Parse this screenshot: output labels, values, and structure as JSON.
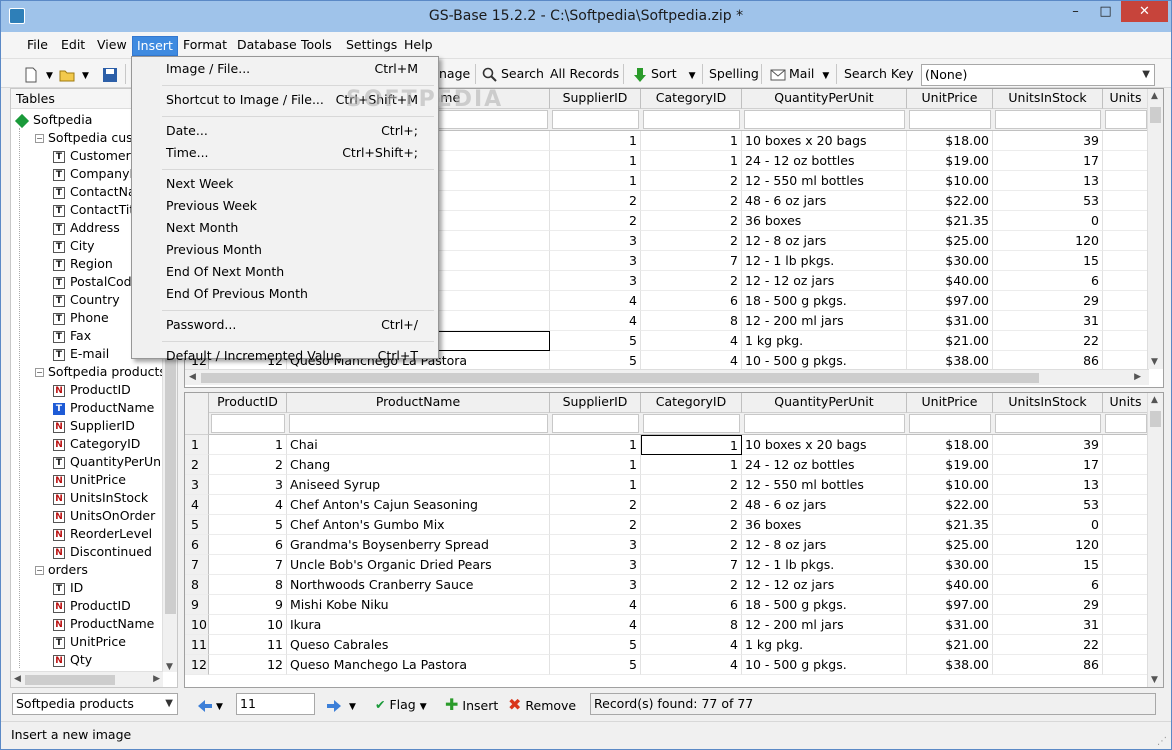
{
  "window": {
    "title": "GS-Base 15.2.2 - C:\\Softpedia\\Softpedia.zip *",
    "min": "–",
    "max": "□",
    "close": "✕"
  },
  "menubar": [
    "File",
    "Edit",
    "View",
    "Insert",
    "Format",
    "Database",
    "Tools",
    "Settings",
    "Help"
  ],
  "toolbar": {
    "image_partial": "nage",
    "search": "Search",
    "all_records": "All Records",
    "sort": "Sort",
    "spelling": "Spelling",
    "mail": "Mail",
    "search_key": "Search Key",
    "search_key_value": "(None)"
  },
  "left_panel": {
    "header": "Tables",
    "tree": [
      {
        "label": "Softpedia",
        "icon": "database-icon",
        "level": 0
      },
      {
        "label": "Softpedia cust",
        "icon": "table-icon",
        "level": 1,
        "exp": "−"
      },
      {
        "label": "CustomerID",
        "icon": "text-field-icon",
        "level": 2
      },
      {
        "label": "CompanyN",
        "icon": "text-field-icon",
        "level": 2
      },
      {
        "label": "ContactNa",
        "icon": "text-field-icon",
        "level": 2
      },
      {
        "label": "ContactTitl",
        "icon": "text-field-icon",
        "level": 2
      },
      {
        "label": "Address",
        "icon": "text-field-icon",
        "level": 2
      },
      {
        "label": "City",
        "icon": "text-field-icon",
        "level": 2
      },
      {
        "label": "Region",
        "icon": "text-field-icon",
        "level": 2
      },
      {
        "label": "PostalCode",
        "icon": "text-field-icon",
        "level": 2
      },
      {
        "label": "Country",
        "icon": "text-field-icon",
        "level": 2
      },
      {
        "label": "Phone",
        "icon": "text-field-icon",
        "level": 2
      },
      {
        "label": "Fax",
        "icon": "text-field-icon",
        "level": 2
      },
      {
        "label": "E-mail",
        "icon": "text-field-icon",
        "level": 2
      },
      {
        "label": "Softpedia products",
        "icon": "table-active-icon",
        "level": 1,
        "exp": "−"
      },
      {
        "label": "ProductID",
        "icon": "number-field-icon",
        "level": 2
      },
      {
        "label": "ProductName",
        "icon": "text-field-selected-icon",
        "level": 2
      },
      {
        "label": "SupplierID",
        "icon": "number-field-icon",
        "level": 2
      },
      {
        "label": "CategoryID",
        "icon": "number-field-icon",
        "level": 2
      },
      {
        "label": "QuantityPerUnit",
        "icon": "text-field-icon",
        "level": 2
      },
      {
        "label": "UnitPrice",
        "icon": "number-field-icon",
        "level": 2
      },
      {
        "label": "UnitsInStock",
        "icon": "number-field-icon",
        "level": 2
      },
      {
        "label": "UnitsOnOrder",
        "icon": "number-field-icon",
        "level": 2
      },
      {
        "label": "ReorderLevel",
        "icon": "number-field-icon",
        "level": 2
      },
      {
        "label": "Discontinued",
        "icon": "number-field-icon",
        "level": 2
      },
      {
        "label": "orders",
        "icon": "table-icon",
        "level": 1,
        "exp": "−"
      },
      {
        "label": "ID",
        "icon": "text-field-icon",
        "level": 2
      },
      {
        "label": "ProductID",
        "icon": "number-field-icon",
        "level": 2
      },
      {
        "label": "ProductName",
        "icon": "number-field-icon",
        "level": 2
      },
      {
        "label": "UnitPrice",
        "icon": "text-field-icon",
        "level": 2
      },
      {
        "label": "Qty",
        "icon": "number-field-icon",
        "level": 2
      }
    ]
  },
  "icon_letters": {
    "text": "T",
    "number": "N"
  },
  "grid": {
    "columns": [
      "ProductID",
      "ProductName",
      "SupplierID",
      "CategoryID",
      "QuantityPerUnit",
      "UnitPrice",
      "UnitsInStock",
      "Units"
    ],
    "rows": [
      [
        "1",
        "1",
        "Chai",
        "1",
        "1",
        "10 boxes x 20 bags",
        "$18.00",
        "39"
      ],
      [
        "2",
        "2",
        "Chang",
        "1",
        "1",
        "24 - 12 oz bottles",
        "$19.00",
        "17"
      ],
      [
        "3",
        "3",
        "Aniseed Syrup",
        "1",
        "2",
        "12 - 550 ml bottles",
        "$10.00",
        "13"
      ],
      [
        "4",
        "4",
        "Chef Anton's Cajun Seasoning",
        "2",
        "2",
        "48 - 6 oz jars",
        "$22.00",
        "53"
      ],
      [
        "5",
        "5",
        "Chef Anton's Gumbo Mix",
        "2",
        "2",
        "36 boxes",
        "$21.35",
        "0"
      ],
      [
        "6",
        "6",
        "Grandma's Boysenberry Spread",
        "3",
        "2",
        "12 - 8 oz jars",
        "$25.00",
        "120"
      ],
      [
        "7",
        "7",
        "Uncle Bob's Organic Dried Pears",
        "3",
        "7",
        "12 - 1 lb pkgs.",
        "$30.00",
        "15"
      ],
      [
        "8",
        "8",
        "Northwoods Cranberry Sauce",
        "3",
        "2",
        "12 - 12 oz jars",
        "$40.00",
        "6"
      ],
      [
        "9",
        "9",
        "Mishi Kobe Niku",
        "4",
        "6",
        "18 - 500 g pkgs.",
        "$97.00",
        "29"
      ],
      [
        "10",
        "10",
        "Ikura",
        "4",
        "8",
        "12 - 200 ml jars",
        "$31.00",
        "31"
      ],
      [
        "11",
        "11",
        "Queso Cabrales",
        "5",
        "4",
        "1 kg pkg.",
        "$21.00",
        "22"
      ],
      [
        "12",
        "12",
        "Queso Manchego La Pastora",
        "5",
        "4",
        "10 - 500 g pkgs.",
        "$38.00",
        "86"
      ]
    ],
    "top_partial_names": [
      "",
      "",
      "",
      "oning",
      "",
      "Spread",
      "d Pears",
      "uce",
      "",
      "",
      "",
      "Queso Manchego La Pastora"
    ]
  },
  "insert_menu": {
    "items": [
      {
        "label": "Image / File...",
        "shortcut": "Ctrl+M"
      },
      {
        "sep": true
      },
      {
        "label": "Shortcut to Image / File...",
        "shortcut": "Ctrl+Shift+M"
      },
      {
        "sep": true
      },
      {
        "label": "Date...",
        "shortcut": "Ctrl+;"
      },
      {
        "label": "Time...",
        "shortcut": "Ctrl+Shift+;"
      },
      {
        "sep": true
      },
      {
        "label": "Next Week",
        "shortcut": ""
      },
      {
        "label": "Previous Week",
        "shortcut": ""
      },
      {
        "label": "Next Month",
        "shortcut": ""
      },
      {
        "label": "Previous Month",
        "shortcut": ""
      },
      {
        "label": "End Of Next Month",
        "shortcut": ""
      },
      {
        "label": "End Of Previous Month",
        "shortcut": ""
      },
      {
        "sep": true
      },
      {
        "label": "Password...",
        "shortcut": "Ctrl+/"
      },
      {
        "sep": true
      },
      {
        "label": "Default / Incremented Value",
        "shortcut": "Ctrl+T"
      }
    ]
  },
  "bottombar": {
    "table_select": "Softpedia products",
    "record_input": "11",
    "flag": "Flag",
    "insert": "Insert",
    "remove": "Remove",
    "records_found": "Record(s) found: 77 of 77"
  },
  "statusbar": {
    "text": "Insert a new image"
  },
  "watermark": "SOFTPEDIA"
}
